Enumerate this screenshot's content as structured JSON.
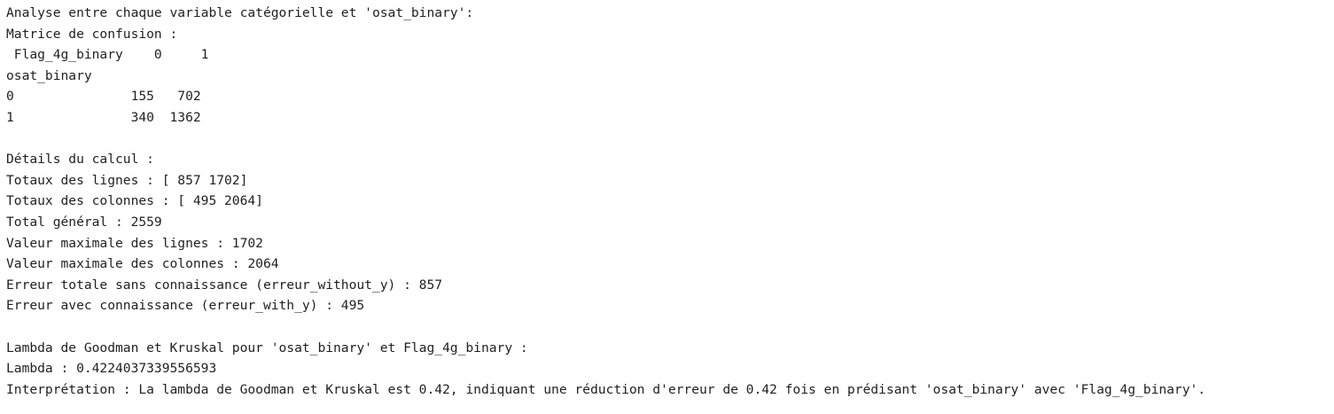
{
  "output": {
    "lines": [
      "Analyse entre chaque variable catégorielle et 'osat_binary':",
      "Matrice de confusion :",
      " Flag_4g_binary    0     1",
      "osat_binary",
      "0               155   702",
      "1               340  1362",
      "",
      "Détails du calcul :",
      "Totaux des lignes : [ 857 1702]",
      "Totaux des colonnes : [ 495 2064]",
      "Total général : 2559",
      "Valeur maximale des lignes : 1702",
      "Valeur maximale des colonnes : 2064",
      "Erreur totale sans connaissance (erreur_without_y) : 857",
      "Erreur avec connaissance (erreur_with_y) : 495",
      "",
      "Lambda de Goodman et Kruskal pour 'osat_binary' et Flag_4g_binary :",
      "Lambda : 0.4224037339556593",
      "Interprétation : La lambda de Goodman et Kruskal est 0.42, indiquant une réduction d'erreur de 0.42 fois en prédisant 'osat_binary' avec 'Flag_4g_binary'."
    ]
  }
}
